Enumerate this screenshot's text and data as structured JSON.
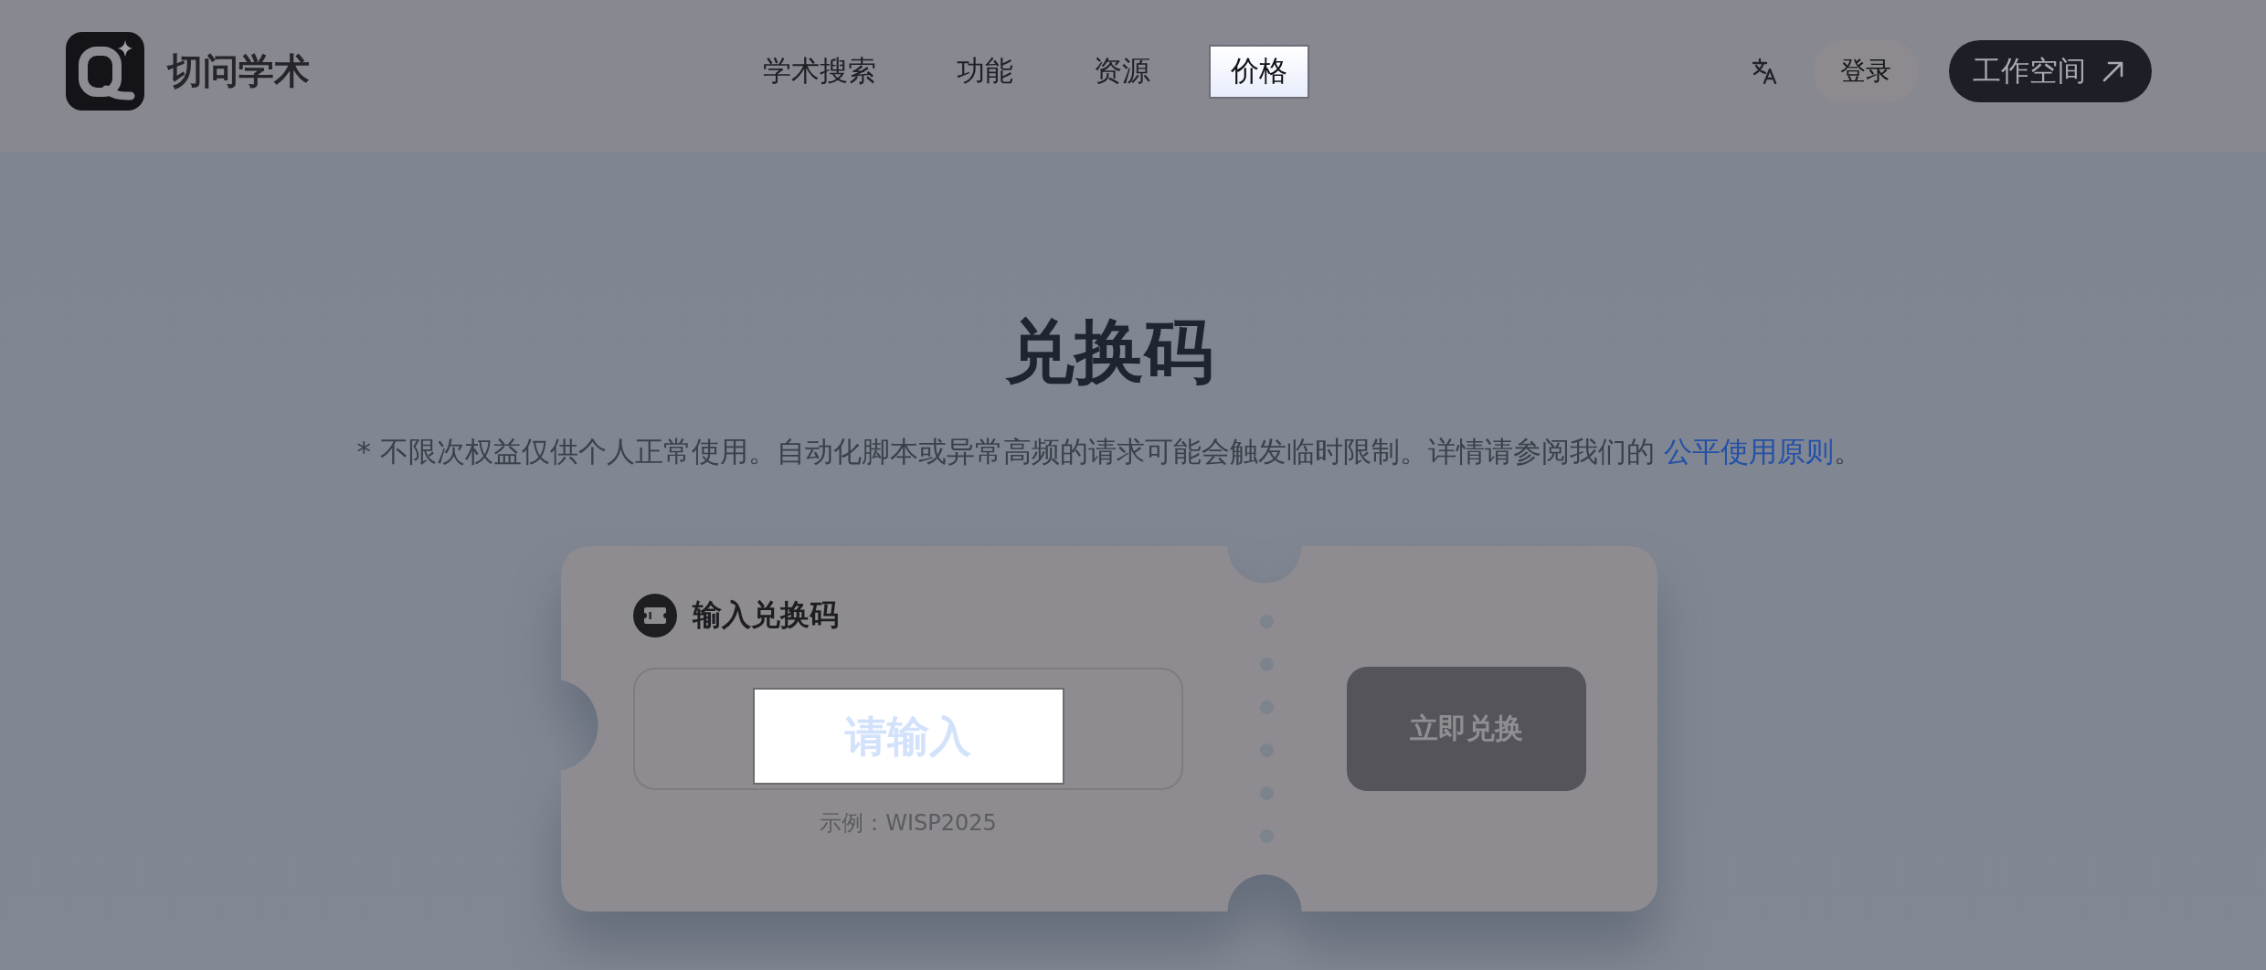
{
  "header": {
    "brand": "切问学术",
    "nav": [
      {
        "label": "学术搜索",
        "selected": false
      },
      {
        "label": "功能",
        "selected": false
      },
      {
        "label": "资源",
        "selected": false
      },
      {
        "label": "价格",
        "selected": true
      }
    ],
    "login_button": "登录",
    "workspace_button": "工作空间"
  },
  "hero": {
    "title": "兑换码",
    "notice": {
      "text": "* 不限次权益仅供个人正常使用。自动化脚本或异常高频的请求可能会触发临时限制。详情请参阅我们的 ",
      "link": "公平使用原则",
      "after": "。"
    }
  },
  "redeem_card": {
    "label": "输入兑换码",
    "input": {
      "placeholder": "请输入"
    },
    "hint": "示例：WISP2025",
    "submit": {
      "label": "立即兑换",
      "disabled": true
    }
  }
}
